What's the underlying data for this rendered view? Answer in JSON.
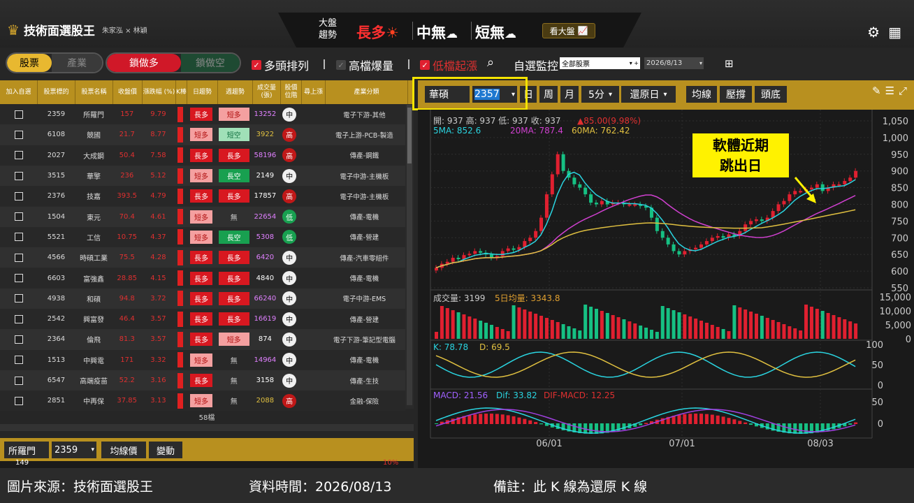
{
  "app": {
    "title": "技術面選股王",
    "authors": "朱家泓 × 林穎"
  },
  "market": {
    "label": "大盤趨勢",
    "long": "長多",
    "mid": "中無",
    "short": "短無",
    "view_button": "看大盤"
  },
  "tabs": {
    "stock": "股票",
    "industry": "產業",
    "lock_long": "鎖做多",
    "lock_short": "鎖做空"
  },
  "filters": {
    "multi": "多頭排列",
    "high_vol": "高檔爆量",
    "low_rise": "低檔起漲",
    "watch_label": "自選監控",
    "watch_select": "全部股票",
    "date": "2026/8/13"
  },
  "table": {
    "headers": [
      "加入自選",
      "股票標的",
      "股票名稱",
      "收盤價",
      "漲跌幅 (%)",
      "K棒",
      "日趨勢",
      "週趨勢",
      "成交量 (張)",
      "股價 位階",
      "尋上漲",
      "產業分類"
    ],
    "rows": [
      {
        "code": "2359",
        "name": "所羅門",
        "price": "157",
        "chg": "9.79",
        "day": "長多",
        "week": "短多",
        "vol": "13252",
        "pos": "中",
        "ind": "電子下游-其他"
      },
      {
        "code": "6108",
        "name": "競國",
        "price": "21.7",
        "chg": "8.77",
        "day": "短多",
        "week": "短空",
        "vol": "3922",
        "pos": "高",
        "ind": "電子上游-PCB-製造"
      },
      {
        "code": "2027",
        "name": "大成鋼",
        "price": "50.4",
        "chg": "7.58",
        "day": "長多",
        "week": "長多",
        "vol": "58196",
        "pos": "高",
        "ind": "傳產-鋼鐵"
      },
      {
        "code": "3515",
        "name": "華擎",
        "price": "236",
        "chg": "5.12",
        "day": "短多",
        "week": "長空",
        "vol": "2149",
        "pos": "中",
        "ind": "電子中游-主機板"
      },
      {
        "code": "2376",
        "name": "技嘉",
        "price": "393.5",
        "chg": "4.79",
        "day": "長多",
        "week": "長多",
        "vol": "17857",
        "pos": "高",
        "ind": "電子中游-主機板"
      },
      {
        "code": "1504",
        "name": "東元",
        "price": "70.4",
        "chg": "4.61",
        "day": "短多",
        "week": "無",
        "vol": "22654",
        "pos": "低",
        "ind": "傳產-電機"
      },
      {
        "code": "5521",
        "name": "工信",
        "price": "10.75",
        "chg": "4.37",
        "day": "短多",
        "week": "長空",
        "vol": "5308",
        "pos": "低",
        "ind": "傳產-營建"
      },
      {
        "code": "4566",
        "name": "時碩工業",
        "price": "75.5",
        "chg": "4.28",
        "day": "長多",
        "week": "長多",
        "vol": "6420",
        "pos": "中",
        "ind": "傳產-汽車零組件"
      },
      {
        "code": "6603",
        "name": "富強鑫",
        "price": "28.85",
        "chg": "4.15",
        "day": "長多",
        "week": "長多",
        "vol": "4840",
        "pos": "中",
        "ind": "傳產-電機"
      },
      {
        "code": "4938",
        "name": "和碩",
        "price": "94.8",
        "chg": "3.72",
        "day": "長多",
        "week": "長多",
        "vol": "66240",
        "pos": "中",
        "ind": "電子中游-EMS"
      },
      {
        "code": "2542",
        "name": "興富發",
        "price": "46.4",
        "chg": "3.57",
        "day": "長多",
        "week": "長多",
        "vol": "16619",
        "pos": "中",
        "ind": "傳產-營建"
      },
      {
        "code": "2364",
        "name": "倫飛",
        "price": "81.3",
        "chg": "3.57",
        "day": "長多",
        "week": "短多",
        "vol": "874",
        "pos": "中",
        "ind": "電子下游-筆記型電腦"
      },
      {
        "code": "1513",
        "name": "中興電",
        "price": "171",
        "chg": "3.32",
        "day": "短多",
        "week": "無",
        "vol": "14964",
        "pos": "中",
        "ind": "傳產-電機"
      },
      {
        "code": "6547",
        "name": "高端疫苗",
        "price": "52.2",
        "chg": "3.16",
        "day": "長多",
        "week": "無",
        "vol": "3158",
        "pos": "中",
        "ind": "傳產-生技"
      },
      {
        "code": "2851",
        "name": "中再保",
        "price": "37.85",
        "chg": "3.13",
        "day": "短多",
        "week": "無",
        "vol": "2088",
        "pos": "高",
        "ind": "金融-保險"
      }
    ],
    "count": "58檔"
  },
  "bottom": {
    "name": "所羅門",
    "code": "2359",
    "btn_ma": "均線價",
    "btn_change": "變動",
    "left_num": "149",
    "right_pct": "10%"
  },
  "toolbar": {
    "stock_name": "華碩",
    "stock_code": "2357",
    "day": "日",
    "week": "周",
    "month": "月",
    "min": "5分",
    "restore": "還原日",
    "ma": "均線",
    "pressure": "壓撐",
    "head": "頭底"
  },
  "chart": {
    "ohlc": "開: 937 高: 937 低: 937 收: 937",
    "change": "▲85.00(9.98%)",
    "ma5": "5MA: 852.6",
    "ma20": "20MA: 787.4",
    "ma60": "60MA: 762.42",
    "callout1": "軟體近期",
    "callout2": "跳出日",
    "vol_label": "成交量: 3199",
    "vol_ma": "5日均量: 3343.8",
    "k_label": "K: 78.78",
    "d_label": "D: 69.5",
    "macd": "MACD: 21.56",
    "dif": "Dif: 33.82",
    "difmacd": "DIF-MACD: 12.25",
    "price_ticks": [
      "1,050",
      "1,000",
      "950",
      "900",
      "850",
      "800",
      "750",
      "700",
      "650",
      "600",
      "550"
    ],
    "vol_ticks": [
      "15,000",
      "10,000",
      "5,000",
      "0"
    ],
    "kd_ticks": [
      "100",
      "50",
      "0"
    ],
    "macd_ticks": [
      "50",
      "0"
    ],
    "dates": [
      "06/01",
      "07/01",
      "08/03"
    ]
  },
  "footer": {
    "source": "圖片來源：技術面選股王",
    "time": "資料時間：2026/08/13",
    "note": "備註：此 K 線為還原 K 線"
  },
  "colors": {
    "gold": "#b8901f",
    "up": "#e02030",
    "down": "#16c083",
    "ma5": "#2ad4e0",
    "ma20": "#d040d0",
    "ma60": "#e0c040"
  }
}
